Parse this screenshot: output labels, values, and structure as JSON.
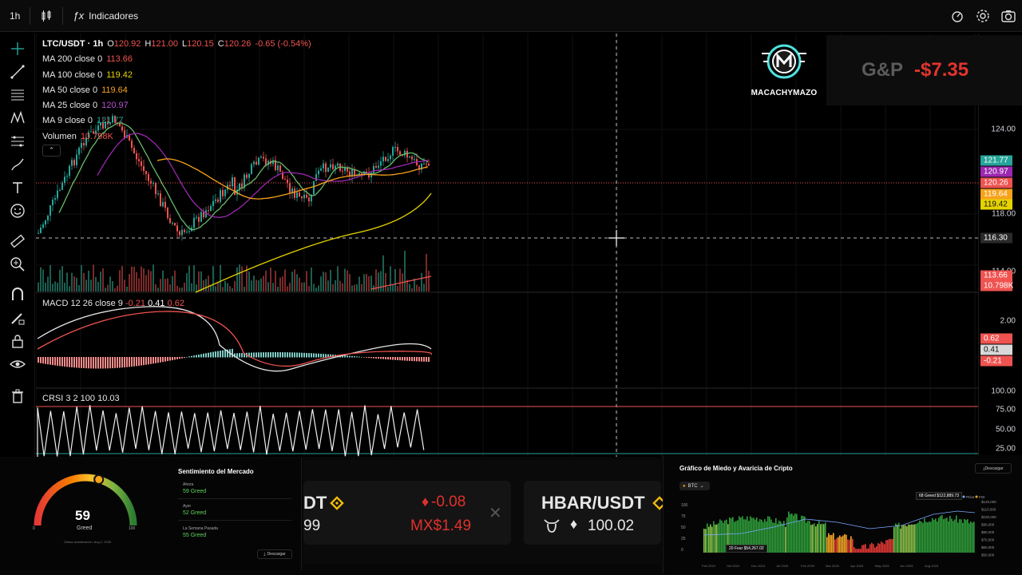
{
  "topbar": {
    "interval": "1h",
    "indicators_label": "Indicadores",
    "icons": [
      "candles-icon",
      "indicators-icon",
      "alert-icon",
      "settings-icon",
      "camera-icon"
    ]
  },
  "legend": {
    "symbol": "LTC/USDT · 1h",
    "o_label": "O",
    "o": "120.92",
    "h_label": "H",
    "h": "121.00",
    "l_label": "L",
    "l": "120.15",
    "c_label": "C",
    "c": "120.26",
    "change": "-0.65 (-0.54%)",
    "ma200_label": "MA 200 close 0",
    "ma200": "113.66",
    "ma100_label": "MA 100 close 0",
    "ma100": "119.42",
    "ma50_label": "MA 50 close 0",
    "ma50": "119.64",
    "ma25_label": "MA 25 close 0",
    "ma25": "120.97",
    "ma9_label": "MA 9 close 0",
    "ma9": "121.77",
    "vol_label": "Volumen",
    "vol": "10.798K",
    "collapse_glyph": "⌃"
  },
  "macd": {
    "label": "MACD 12 26 close 9",
    "v1": "-0.21",
    "v2": "0.41",
    "v3": "0.62"
  },
  "crsi": {
    "label": "CRSI 3 2 100",
    "value": "10.03"
  },
  "price_axis": {
    "labels": [
      "124.00",
      "118.00",
      "114.00",
      "2.00",
      "100.00",
      "75.00",
      "50.00",
      "25.00"
    ],
    "tags": [
      {
        "value": "121.77",
        "color": "#26a69a"
      },
      {
        "value": "120.97",
        "color": "#9c27b0"
      },
      {
        "value": "120.26",
        "color": "#ef5350"
      },
      {
        "value": "119.64",
        "color": "#f7a21b"
      },
      {
        "value": "119.42",
        "color": "#e6d300"
      },
      {
        "value": "116.30",
        "color": "#2a2a2a"
      },
      {
        "value": "113.66",
        "color": "#ef5350"
      },
      {
        "value": "10.798K",
        "color": "#ef5350"
      },
      {
        "value": "0.62",
        "color": "#ef5350"
      },
      {
        "value": "0.41",
        "color": "#d9d9d9"
      },
      {
        "value": "-0.21",
        "color": "#ef5350"
      }
    ]
  },
  "logo": {
    "text": "MACACHYMAZO"
  },
  "gp": {
    "label": "G&P",
    "value": "-$7.35"
  },
  "sentiment": {
    "title": "Sentimiento del Mercado",
    "value": "59",
    "state": "Greed",
    "min": "0",
    "max": "100",
    "rows": [
      {
        "label": "Ahora",
        "value": "59 Greed"
      },
      {
        "label": "Ayer",
        "value": "52 Greed"
      },
      {
        "label": "La Semana Pasada",
        "value": "55 Greed"
      }
    ],
    "updated": "Última actualización: Aug 2, 2025",
    "download": "Descargar"
  },
  "ticker": {
    "items": [
      {
        "pair": "DT",
        "change": "-0.08",
        "price": "99",
        "price_mxn": "MX$1.49"
      },
      {
        "pair": "HBAR/USDT",
        "price": "100.02"
      }
    ]
  },
  "fear_greed": {
    "title": "Gráfico de Miedo y Avaricia de Cripto",
    "download": "Descargar",
    "coin": "BTC",
    "tooltip_1": "68 Greed $122,889.73",
    "tooltip_2": "20 Fear $54,267.02",
    "y_left": [
      "100",
      "75",
      "50",
      "25",
      "0"
    ],
    "y_right": [
      "$120,000",
      "$110,000",
      "$100,000",
      "$90,000",
      "$80,000",
      "$70,000",
      "$60,000",
      "$50,000"
    ],
    "x_labels": [
      "Feb 2024",
      "Oct 2024",
      "Dec 2024",
      "Jul 2025",
      "Feb 2025",
      "Mar 2025",
      "Apr 2025",
      "May 2025",
      "Jun 2025",
      "Aug 2025"
    ],
    "legend": [
      "Price",
      "FGI"
    ]
  }
}
